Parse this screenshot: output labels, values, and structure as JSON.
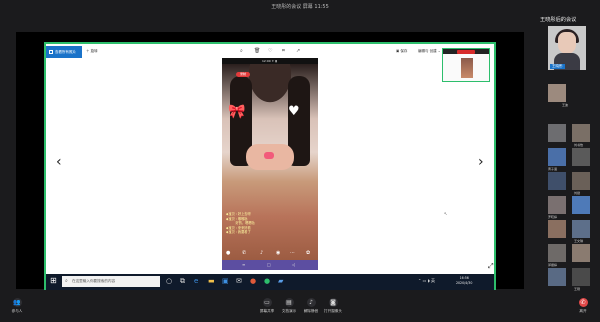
{
  "window": {
    "title": "王晓彤的会议 屏幕 11:55"
  },
  "share": {
    "viewer_title": "照片 · 171支付",
    "tab_label": "查看所有照片",
    "view_label": "旋转",
    "save_label": "保存",
    "edit_label": "编辑与 创建",
    "mini_rec": "录制中"
  },
  "phone": {
    "status": "12:00  ✦ ▮",
    "rec": "录制",
    "chat": [
      "◆宝贝 : 好上去呀",
      "◆宝贝 : 嘟嘟哒",
      "　　　好的，嗯嗯哒",
      "◆宝贝 : 来来好看",
      "◆宝贝 : 我要看了"
    ]
  },
  "taskbar": {
    "search_placeholder": "在这里输入你要搜索的内容",
    "time": "16:56",
    "date": "2020/4/30"
  },
  "sidebar": {
    "title": "王晓彤后的会议",
    "main_name": "王晓彤",
    "participants": [
      {
        "name": "王迪"
      },
      {
        "name": ""
      },
      {
        "name": "刘书怡"
      },
      {
        "name": ""
      },
      {
        "name": "黄子涵"
      },
      {
        "name": ""
      },
      {
        "name": "刘健"
      },
      {
        "name": ""
      },
      {
        "name": "罗晓婷"
      },
      {
        "name": ""
      },
      {
        "name": "王文琪"
      },
      {
        "name": ""
      },
      {
        "name": "郭振婷"
      },
      {
        "name": ""
      },
      {
        "name": "王刚"
      }
    ]
  },
  "bottom": {
    "participants_label": "参与人",
    "share_label": "屏幕共享",
    "doc_label": "文档演示",
    "mute_label": "解除静音",
    "video_label": "打开摄像头",
    "leave_label": "离开"
  }
}
